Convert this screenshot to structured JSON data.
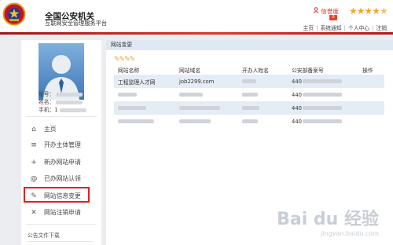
{
  "header": {
    "site_title": "全国公安机关",
    "site_subtitle": "互联网安全管理服务平台",
    "credit_label": "信誉度",
    "credit_badge": "0",
    "stars": "★★★★",
    "star_dim": "★",
    "nav": [
      "主页",
      "系统通知",
      "个人中心",
      "注销"
    ]
  },
  "user": {
    "account_label": "账号：",
    "name_label": "姓名：",
    "phone_label": "手机：1"
  },
  "sidebar": {
    "items": [
      {
        "icon": "⌂",
        "label": "主页"
      },
      {
        "icon": "≡",
        "label": "开办主体管理"
      },
      {
        "icon": "+",
        "label": "新办网站申请"
      },
      {
        "icon": "@",
        "label": "已办网站认领"
      },
      {
        "icon": "✎",
        "label": "网站信息变更"
      },
      {
        "icon": "✕",
        "label": "网站注销申请"
      }
    ],
    "docs_label": "公告文件下载"
  },
  "main": {
    "panel_title": "网站变更",
    "columns": [
      "网站名称",
      "网站域名",
      "开办人姓名",
      "公安部备案号",
      "操作"
    ],
    "rows": [
      {
        "name": "工程监理人才网",
        "domain": "job2299.com",
        "record_prefix": "440"
      },
      {
        "name": "",
        "domain": "",
        "record_prefix": "440"
      },
      {
        "name": "",
        "domain": "",
        "record_prefix": "440"
      },
      {
        "name": "",
        "domain": "",
        "record_prefix": "440"
      }
    ]
  },
  "watermark": {
    "logo": "Bai du 经验",
    "url": "jingyan.baidu.com"
  },
  "colors": {
    "brand_red": "#d92f1e",
    "highlight_red": "#e02020",
    "table_stripe": "#e4ecf5",
    "star_gold": "#f5a623"
  }
}
